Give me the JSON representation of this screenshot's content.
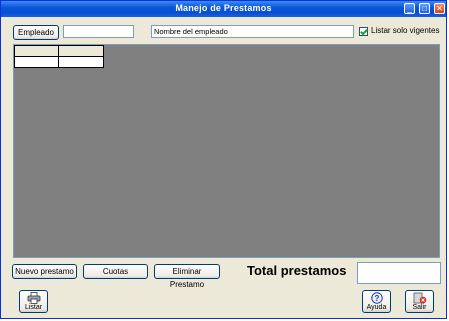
{
  "window": {
    "title": "Manejo de Prestamos",
    "controls": {
      "minimize": "_",
      "maximize": "□",
      "close": "✕"
    }
  },
  "toolbar": {
    "empleado_button": "Empleado",
    "empleado_code_value": "",
    "empleado_name_value": "Nombre del empleado",
    "vigentes_label": "Listar solo vigentes",
    "vigentes_checked": true
  },
  "actions": {
    "nuevo_label": "Nuevo prestamo",
    "cuotas_label": "Cuotas",
    "eliminar_label": "Eliminar Prestamo"
  },
  "totals": {
    "label": "Total prestamos",
    "value": ""
  },
  "footer": {
    "listar_label": "Listar",
    "ayuda_label": "Ayuda",
    "salir_label": "Salir"
  },
  "colors": {
    "titlebar": "#0b56d8",
    "grid_background": "#808080",
    "window_background": "#ece9d8"
  },
  "icons": {
    "listar": "printer-icon",
    "ayuda": "help-icon",
    "salir": "exit-icon"
  }
}
